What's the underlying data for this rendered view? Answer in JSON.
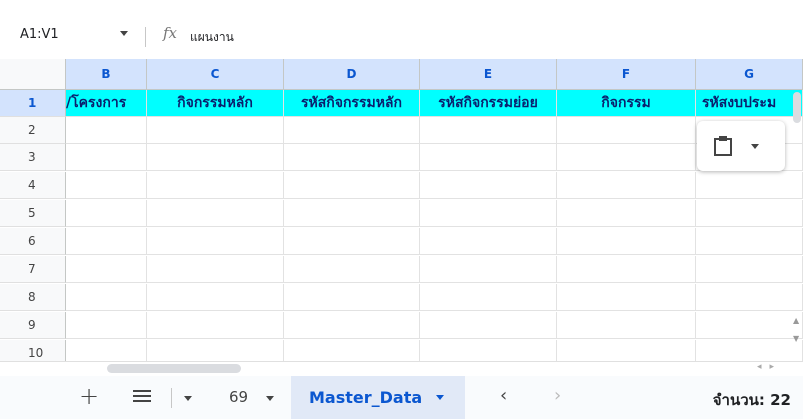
{
  "formula_bar": {
    "name_box": "A1:V1",
    "fx_label": "fx",
    "value": "แผนงาน"
  },
  "columns": [
    "B",
    "C",
    "D",
    "E",
    "F",
    "G"
  ],
  "rows": [
    "1",
    "2",
    "3",
    "4",
    "5",
    "6",
    "7",
    "8",
    "9",
    "10"
  ],
  "header_cells": [
    "/โครงการ",
    "กิจกรรมหลัก",
    "รหัสกิจกรรมหลัก",
    "รหัสกิจกรรมย่อย",
    "กิจกรรม",
    "รหัสงบประม"
  ],
  "colors": {
    "header_fill": "#00ffff",
    "selected_header": "#d3e3fd",
    "accent": "#0b57d0"
  },
  "paste_popup": {
    "icon": "clipboard-icon"
  },
  "sheet_bar": {
    "add_icon": "+",
    "sheet_number": "69",
    "active_sheet": "Master_Data",
    "prev": "‹",
    "next": "›",
    "summary": "จำนวน: 22"
  }
}
